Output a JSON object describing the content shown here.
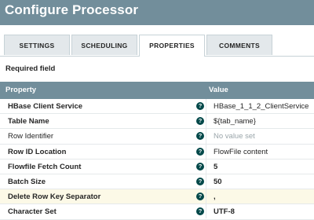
{
  "header": {
    "title": "Configure Processor"
  },
  "tabs": [
    {
      "label": "SETTINGS"
    },
    {
      "label": "SCHEDULING"
    },
    {
      "label": "PROPERTIES",
      "active": true
    },
    {
      "label": "COMMENTS"
    }
  ],
  "required_label": "Required field",
  "table": {
    "col_property": "Property",
    "col_value": "Value",
    "rows": [
      {
        "name": "HBase Client Service",
        "value": "HBase_1_1_2_ClientService",
        "required": true
      },
      {
        "name": "Table Name",
        "value": "${tab_name}",
        "required": true
      },
      {
        "name": "Row Identifier",
        "value": "No value set",
        "required": false,
        "empty": true
      },
      {
        "name": "Row ID Location",
        "value": "FlowFile content",
        "required": true
      },
      {
        "name": "Flowfile Fetch Count",
        "value": "5",
        "required": true
      },
      {
        "name": "Batch Size",
        "value": "50",
        "required": true
      },
      {
        "name": "Delete Row Key Separator",
        "value": ",",
        "required": true,
        "highlighted": true
      },
      {
        "name": "Character Set",
        "value": "UTF-8",
        "required": true
      }
    ],
    "help_icon": "?"
  },
  "colors": {
    "header_bg": "#728e9b",
    "help_icon_bg": "#004849",
    "highlight_row": "#fcf9e7"
  }
}
